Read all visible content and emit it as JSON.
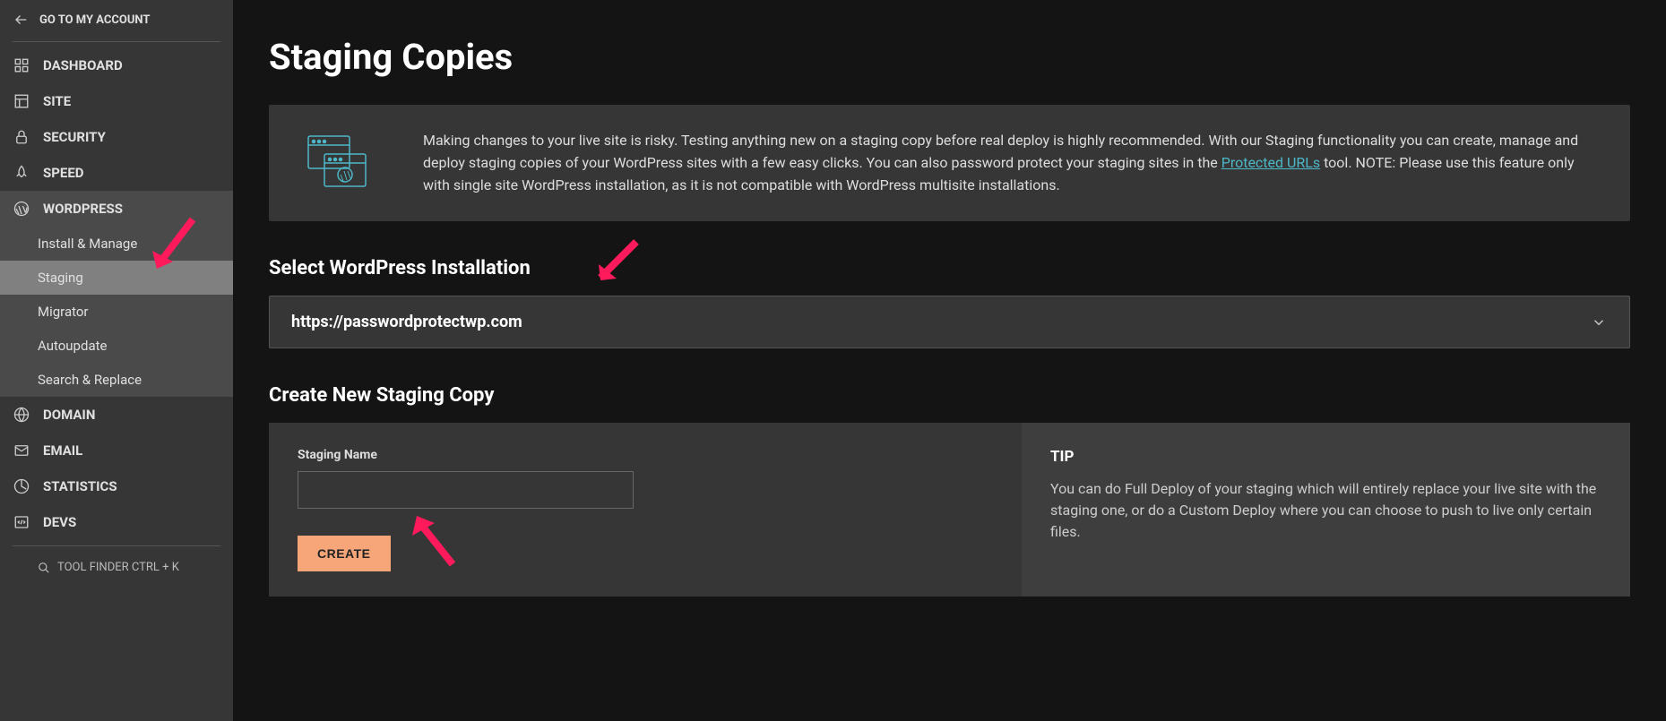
{
  "sidebar": {
    "back_label": "GO TO MY ACCOUNT",
    "items": [
      {
        "label": "DASHBOARD"
      },
      {
        "label": "SITE"
      },
      {
        "label": "SECURITY"
      },
      {
        "label": "SPEED"
      },
      {
        "label": "WORDPRESS"
      },
      {
        "label": "DOMAIN"
      },
      {
        "label": "EMAIL"
      },
      {
        "label": "STATISTICS"
      },
      {
        "label": "DEVS"
      }
    ],
    "wordpress_subitems": [
      {
        "label": "Install & Manage"
      },
      {
        "label": "Staging"
      },
      {
        "label": "Migrator"
      },
      {
        "label": "Autoupdate"
      },
      {
        "label": "Search & Replace"
      }
    ],
    "tool_finder_label": "TOOL FINDER CTRL + K"
  },
  "page": {
    "title": "Staging Copies",
    "info_text_1": "Making changes to your live site is risky. Testing anything new on a staging copy before real deploy is highly recommended. With our Staging functionality you can create, manage and deploy staging copies of your WordPress sites with a few easy clicks. You can also password protect your staging sites in the ",
    "info_link": "Protected URLs",
    "info_text_2": " tool. NOTE: Please use this feature only with single site WordPress installation, as it is not compatible with WordPress multisite installations.",
    "select_title": "Select WordPress Installation",
    "selected_url": "https://passwordprotectwp.com",
    "create_title": "Create New Staging Copy",
    "staging_name_label": "Staging Name",
    "staging_name_value": "",
    "create_button": "CREATE",
    "tip_title": "TIP",
    "tip_text": "You can do Full Deploy of your staging which will entirely replace your live site with the staging one, or do a Custom Deploy where you can choose to push to live only certain files."
  }
}
